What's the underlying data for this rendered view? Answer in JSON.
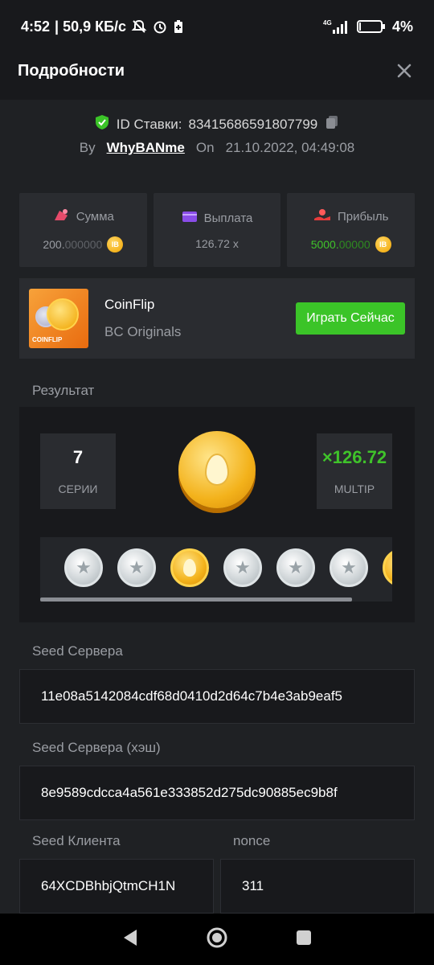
{
  "status_bar": {
    "time": "4:52",
    "speed": "| 50,9 КБ/с",
    "network": "4G",
    "battery": "4%"
  },
  "header": {
    "title": "Подробности",
    "close_icon": "close-icon"
  },
  "bet": {
    "id_label": "ID Ставки:",
    "id_value": "83415686591807799",
    "by_label": "By",
    "username": "WhyBANme",
    "on_label": "On",
    "datetime": "21.10.2022, 04:49:08"
  },
  "stats": [
    {
      "label": "Сумма",
      "value_main": "200.",
      "value_dim": "000000",
      "icon": "money-bag-icon"
    },
    {
      "label": "Выплата",
      "value_main": "126.72 x",
      "value_dim": "",
      "icon": "wallet-icon"
    },
    {
      "label": "Прибыль",
      "value_main": "5000.",
      "value_dim": "00000",
      "icon": "hand-coin-icon"
    }
  ],
  "currency_badge": "IB",
  "game": {
    "name": "CoinFlip",
    "provider": "BC Originals",
    "thumb_label": "COINFLIP",
    "play_label": "Играть Сейчас"
  },
  "result": {
    "label": "Результат",
    "series_value": "7",
    "series_label": "СЕРИИ",
    "multiplier_value": "×126.72",
    "multiplier_label": "MULTIP",
    "coins": [
      "silver",
      "silver",
      "gold",
      "silver",
      "silver",
      "silver",
      "gold"
    ]
  },
  "seeds": {
    "server_label": "Seed Сервера",
    "server_value": "11e08a5142084cdf68d0410d2d64c7b4e3ab9eaf5",
    "server_hash_label": "Seed Сервера (хэш)",
    "server_hash_value": "8e9589cdcca4a561e333852d275dc90885ec9b8f",
    "client_label": "Seed Клиента",
    "client_value": "64XCDBhbjQtmCH1N",
    "nonce_label": "nonce",
    "nonce_value": "311"
  },
  "colors": {
    "accent_green": "#3bc428",
    "background": "#1f2124",
    "card": "#2a2c30"
  }
}
